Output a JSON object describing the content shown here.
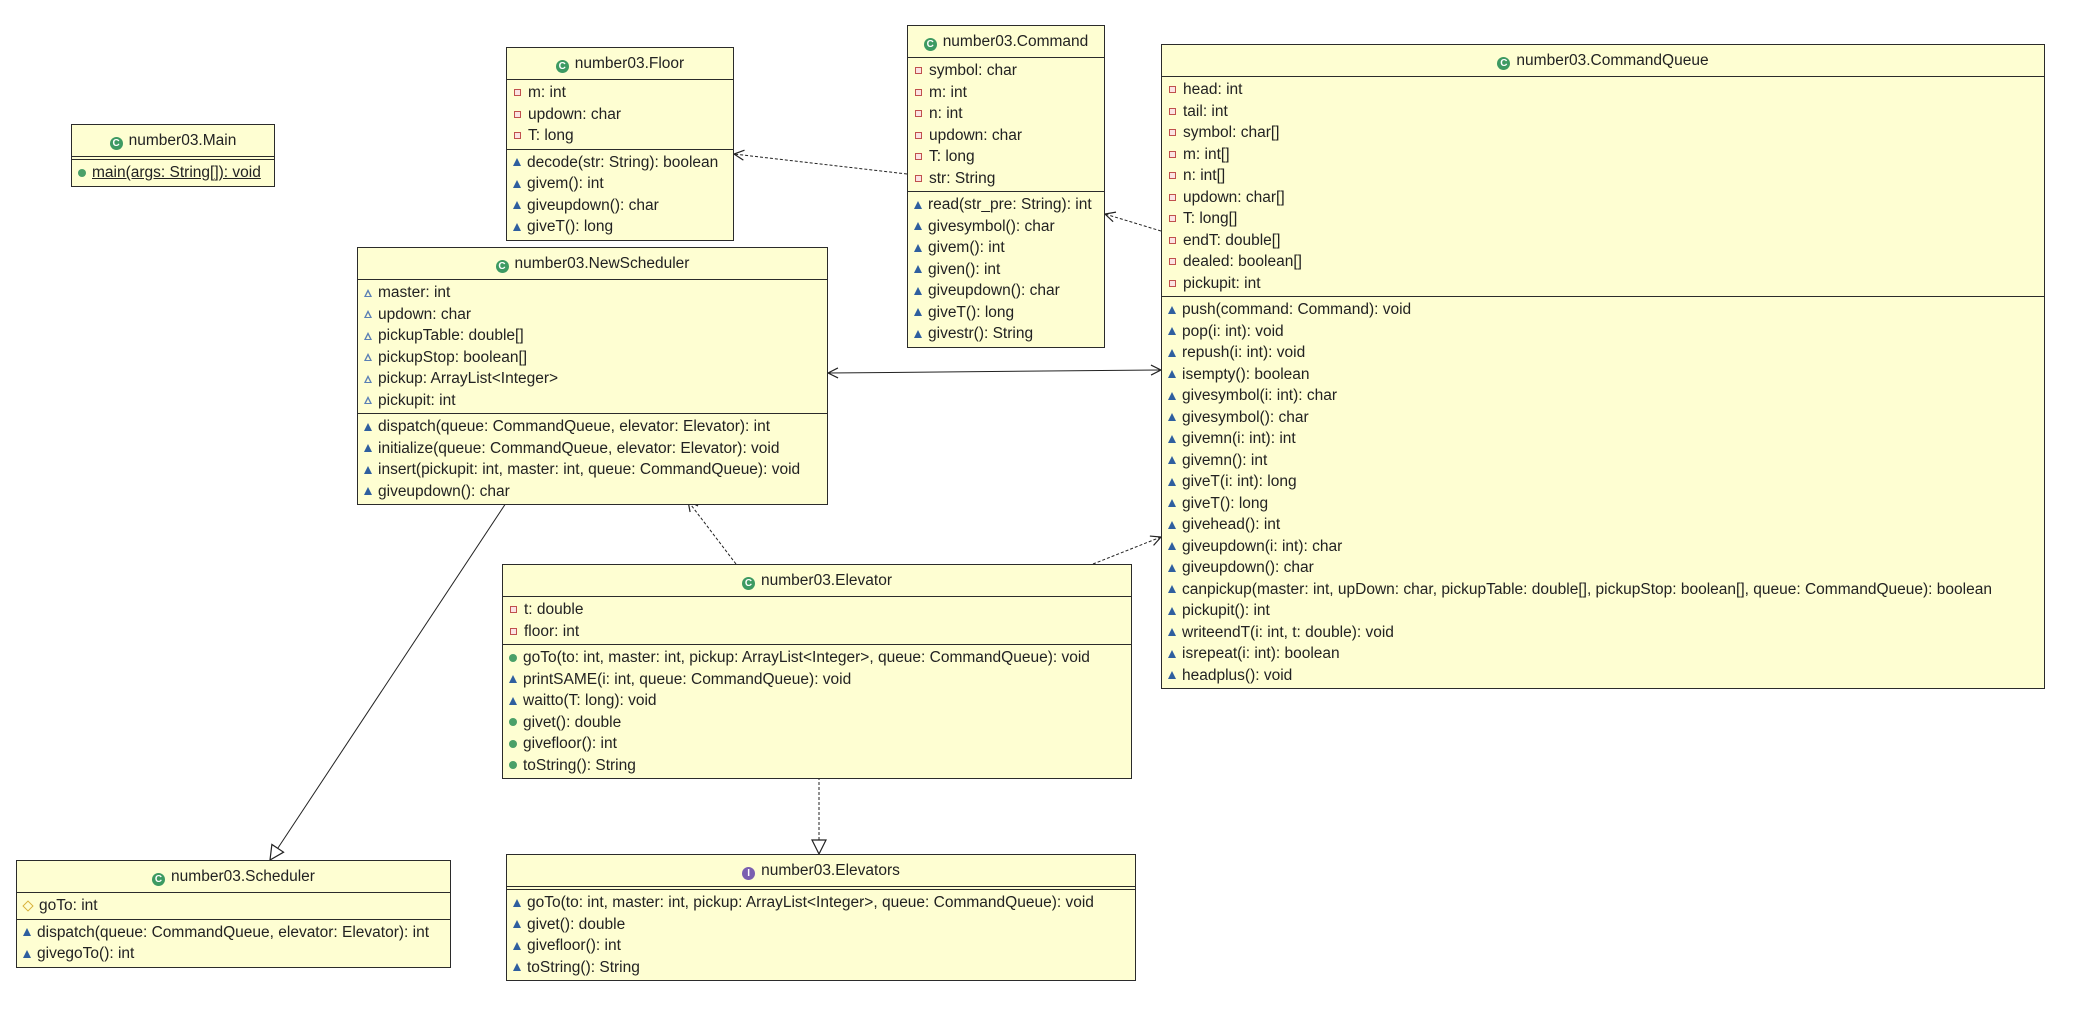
{
  "colors": {
    "box_fill": "#fefed2",
    "border": "#2b2b2b",
    "class_icon": "#3d9a62",
    "interface_icon": "#7a5fb0",
    "private": "#c0504d",
    "package": "#2f5f9f",
    "public": "#4aa068",
    "protected": "#d9b23c"
  },
  "classes": [
    {
      "name": "number03.Main",
      "kind": "class",
      "icon": "class-icon",
      "attributes": [],
      "methods": [
        {
          "vis": "public",
          "text": "main(args: String[]): void",
          "static": true
        }
      ]
    },
    {
      "name": "number03.Floor",
      "kind": "class",
      "icon": "class-icon",
      "attributes": [
        {
          "vis": "private",
          "text": "m: int"
        },
        {
          "vis": "private",
          "text": "updown: char"
        },
        {
          "vis": "private",
          "text": "T: long"
        }
      ],
      "methods": [
        {
          "vis": "package",
          "text": "decode(str: String): boolean"
        },
        {
          "vis": "package",
          "text": "givem(): int"
        },
        {
          "vis": "package",
          "text": "giveupdown(): char"
        },
        {
          "vis": "package",
          "text": "giveT(): long"
        }
      ]
    },
    {
      "name": "number03.Command",
      "kind": "class",
      "icon": "class-icon",
      "attributes": [
        {
          "vis": "private",
          "text": "symbol: char"
        },
        {
          "vis": "private",
          "text": "m: int"
        },
        {
          "vis": "private",
          "text": "n: int"
        },
        {
          "vis": "private",
          "text": "updown: char"
        },
        {
          "vis": "private",
          "text": "T: long"
        },
        {
          "vis": "private",
          "text": "str: String"
        }
      ],
      "methods": [
        {
          "vis": "package",
          "text": "read(str_pre: String): int"
        },
        {
          "vis": "package",
          "text": "givesymbol(): char"
        },
        {
          "vis": "package",
          "text": "givem(): int"
        },
        {
          "vis": "package",
          "text": "given(): int"
        },
        {
          "vis": "package",
          "text": "giveupdown(): char"
        },
        {
          "vis": "package",
          "text": "giveT(): long"
        },
        {
          "vis": "package",
          "text": "givestr(): String"
        }
      ]
    },
    {
      "name": "number03.CommandQueue",
      "kind": "class",
      "icon": "class-icon",
      "attributes": [
        {
          "vis": "private",
          "text": "head: int"
        },
        {
          "vis": "private",
          "text": "tail: int"
        },
        {
          "vis": "private",
          "text": "symbol: char[]"
        },
        {
          "vis": "private",
          "text": "m: int[]"
        },
        {
          "vis": "private",
          "text": "n: int[]"
        },
        {
          "vis": "private",
          "text": "updown: char[]"
        },
        {
          "vis": "private",
          "text": "T: long[]"
        },
        {
          "vis": "private",
          "text": "endT: double[]"
        },
        {
          "vis": "private",
          "text": "dealed: boolean[]"
        },
        {
          "vis": "private",
          "text": "pickupit: int"
        }
      ],
      "methods": [
        {
          "vis": "package",
          "text": "push(command: Command): void"
        },
        {
          "vis": "package",
          "text": "pop(i: int): void"
        },
        {
          "vis": "package",
          "text": "repush(i: int): void"
        },
        {
          "vis": "package",
          "text": "isempty(): boolean"
        },
        {
          "vis": "package",
          "text": "givesymbol(i: int): char"
        },
        {
          "vis": "package",
          "text": "givesymbol(): char"
        },
        {
          "vis": "package",
          "text": "givemn(i: int): int"
        },
        {
          "vis": "package",
          "text": "givemn(): int"
        },
        {
          "vis": "package",
          "text": "giveT(i: int): long"
        },
        {
          "vis": "package",
          "text": "giveT(): long"
        },
        {
          "vis": "package",
          "text": "givehead(): int"
        },
        {
          "vis": "package",
          "text": "giveupdown(i: int): char"
        },
        {
          "vis": "package",
          "text": "giveupdown(): char"
        },
        {
          "vis": "package",
          "text": "canpickup(master: int, upDown: char, pickupTable: double[], pickupStop: boolean[], queue: CommandQueue): boolean"
        },
        {
          "vis": "package",
          "text": "pickupit(): int"
        },
        {
          "vis": "package",
          "text": "writeendT(i: int, t: double): void"
        },
        {
          "vis": "package",
          "text": "isrepeat(i: int): boolean"
        },
        {
          "vis": "package",
          "text": "headplus(): void"
        }
      ]
    },
    {
      "name": "number03.NewScheduler",
      "kind": "class",
      "icon": "class-icon",
      "attributes": [
        {
          "vis": "package-field",
          "text": "master: int"
        },
        {
          "vis": "package-field",
          "text": "updown: char"
        },
        {
          "vis": "package-field",
          "text": "pickupTable: double[]"
        },
        {
          "vis": "package-field",
          "text": "pickupStop: boolean[]"
        },
        {
          "vis": "package-field",
          "text": "pickup: ArrayList<Integer>"
        },
        {
          "vis": "package-field",
          "text": "pickupit: int"
        }
      ],
      "methods": [
        {
          "vis": "package",
          "text": "dispatch(queue: CommandQueue, elevator: Elevator): int"
        },
        {
          "vis": "package",
          "text": "initialize(queue: CommandQueue, elevator: Elevator): void"
        },
        {
          "vis": "package",
          "text": "insert(pickupit: int, master: int, queue: CommandQueue): void"
        },
        {
          "vis": "package",
          "text": "giveupdown(): char"
        }
      ]
    },
    {
      "name": "number03.Elevator",
      "kind": "class",
      "icon": "class-icon",
      "attributes": [
        {
          "vis": "private",
          "text": "t: double"
        },
        {
          "vis": "private",
          "text": "floor: int"
        }
      ],
      "methods": [
        {
          "vis": "public",
          "text": "goTo(to: int, master: int, pickup: ArrayList<Integer>, queue: CommandQueue): void"
        },
        {
          "vis": "package",
          "text": "printSAME(i: int, queue: CommandQueue): void"
        },
        {
          "vis": "package",
          "text": "waitto(T: long): void"
        },
        {
          "vis": "public",
          "text": "givet(): double"
        },
        {
          "vis": "public",
          "text": "givefloor(): int"
        },
        {
          "vis": "public",
          "text": "toString(): String"
        }
      ]
    },
    {
      "name": "number03.Scheduler",
      "kind": "class",
      "icon": "class-icon",
      "attributes": [
        {
          "vis": "protected",
          "text": "goTo: int"
        }
      ],
      "methods": [
        {
          "vis": "package",
          "text": "dispatch(queue: CommandQueue, elevator: Elevator): int"
        },
        {
          "vis": "package",
          "text": "givegoTo(): int"
        }
      ]
    },
    {
      "name": "number03.Elevators",
      "kind": "interface",
      "icon": "interface-icon",
      "attributes": [],
      "methods": [
        {
          "vis": "package",
          "text": "goTo(to: int, master: int, pickup: ArrayList<Integer>, queue: CommandQueue): void"
        },
        {
          "vis": "package",
          "text": "givet(): double"
        },
        {
          "vis": "package",
          "text": "givefloor(): int"
        },
        {
          "vis": "package",
          "text": "toString(): String"
        }
      ]
    }
  ],
  "relations": [
    {
      "from": "number03.Command",
      "to": "number03.Floor",
      "type": "dependency"
    },
    {
      "from": "number03.CommandQueue",
      "to": "number03.Command",
      "type": "dependency"
    },
    {
      "from": "number03.NewScheduler",
      "to": "number03.CommandQueue",
      "type": "bidirectional-association"
    },
    {
      "from": "number03.Elevator",
      "to": "number03.NewScheduler",
      "type": "dependency"
    },
    {
      "from": "number03.Elevator",
      "to": "number03.CommandQueue",
      "type": "dependency"
    },
    {
      "from": "number03.NewScheduler",
      "to": "number03.Scheduler",
      "type": "generalization"
    },
    {
      "from": "number03.Elevator",
      "to": "number03.Elevators",
      "type": "realization"
    }
  ]
}
